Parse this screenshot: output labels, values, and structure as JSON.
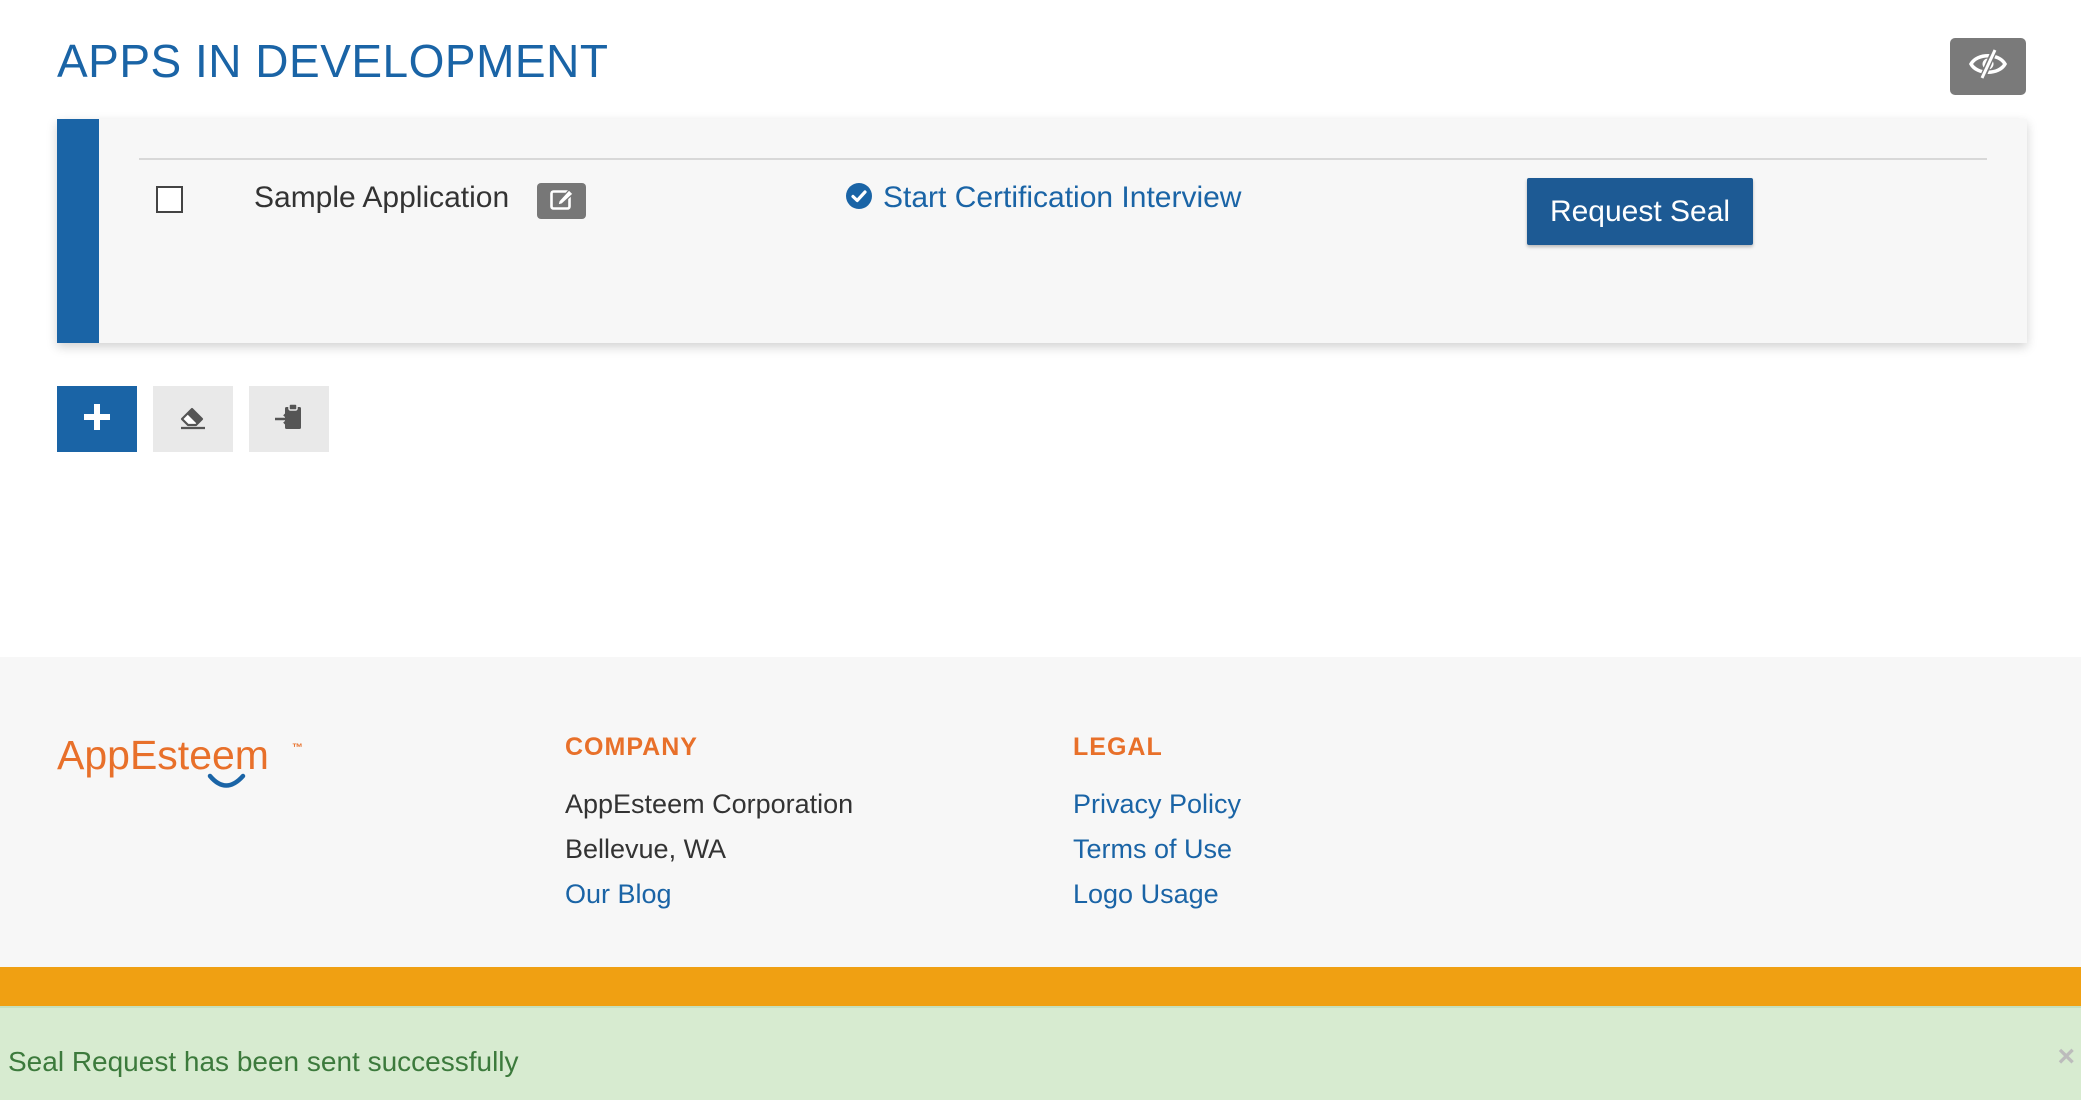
{
  "header": {
    "title": "APPS IN DEVELOPMENT",
    "visibility_icon": "eye-slash-icon"
  },
  "apps": [
    {
      "name": "Sample Application",
      "checked": false,
      "edit_icon": "edit-icon",
      "status_icon": "check-circle-icon",
      "certification_link": "Start Certification Interview",
      "request_seal_label": "Request Seal"
    }
  ],
  "toolbar": {
    "add_icon": "plus-icon",
    "erase_icon": "eraser-icon",
    "import_icon": "clipboard-import-icon"
  },
  "footer": {
    "logo_text": "AppEsteem",
    "logo_tm": "™",
    "company": {
      "heading": "COMPANY",
      "name": "AppEsteem Corporation",
      "location": "Bellevue, WA",
      "blog_link": "Our Blog"
    },
    "legal": {
      "heading": "LEGAL",
      "links": [
        "Privacy Policy",
        "Terms of Use",
        "Logo Usage"
      ]
    }
  },
  "notification": {
    "message": "Seal Request has been sent successfully",
    "close_label": "×"
  },
  "colors": {
    "primary": "#1a64a6",
    "button": "#1d5a94",
    "brand_orange": "#e8702a",
    "band_orange": "#f0a012",
    "success_bg": "#d7ebd0",
    "success_text": "#3c7a3c"
  }
}
